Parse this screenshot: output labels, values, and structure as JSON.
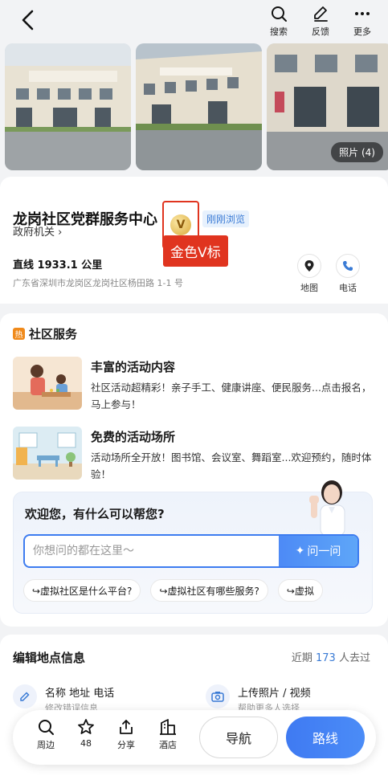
{
  "header": {
    "actions": [
      {
        "label": "搜索",
        "icon": "search-icon"
      },
      {
        "label": "反馈",
        "icon": "edit-icon"
      },
      {
        "label": "更多",
        "icon": "more-icon"
      }
    ]
  },
  "photos": {
    "count_label": "照片 (4)"
  },
  "poi": {
    "title": "龙岗社区党群服务中心",
    "badge_letter": "V",
    "recent_tag": "刚刚浏览",
    "category": "政府机关",
    "annotation": "金色V标",
    "distance": "直线 1933.1 公里",
    "address": "广东省深圳市龙岗区龙岗社区杨田路 1-1 号",
    "map_label": "地图",
    "phone_label": "电话"
  },
  "service": {
    "hot_tag": "热",
    "title": "社区服务",
    "items": [
      {
        "title": "丰富的活动内容",
        "desc": "社区活动超精彩！亲子手工、健康讲座、便民服务...点击报名，马上参与！"
      },
      {
        "title": "免费的活动场所",
        "desc": "活动场所全开放！图书馆、会议室、舞蹈室...欢迎预约，随时体验！"
      }
    ]
  },
  "assistant": {
    "greeting": "欢迎您，有什么可以帮您?",
    "input_placeholder": "你想问的都在这里～",
    "ask_button": "问一问",
    "chips": [
      "↪虚拟社区是什么平台?",
      "↪虚拟社区有哪些服务?",
      "↪虚拟"
    ]
  },
  "edit": {
    "title": "编辑地点信息",
    "visits_prefix": "近期",
    "visits_num": "173",
    "visits_suffix": "人去过",
    "left_item_title": "名称 地址 电话",
    "left_item_sub": "修改错误信息",
    "right_item_title": "上传照片 / 视频",
    "right_item_sub": "帮助更多人选择"
  },
  "bottom": {
    "items": [
      {
        "label": "周边",
        "icon": "search-icon"
      },
      {
        "label": "48",
        "icon": "star-icon"
      },
      {
        "label": "分享",
        "icon": "share-icon"
      },
      {
        "label": "酒店",
        "icon": "hotel-icon"
      }
    ],
    "nav_button": "导航",
    "route_button": "路线"
  },
  "colors": {
    "accent": "#3f7af2",
    "annotation": "#e0341f",
    "hot": "#f08a1b"
  }
}
